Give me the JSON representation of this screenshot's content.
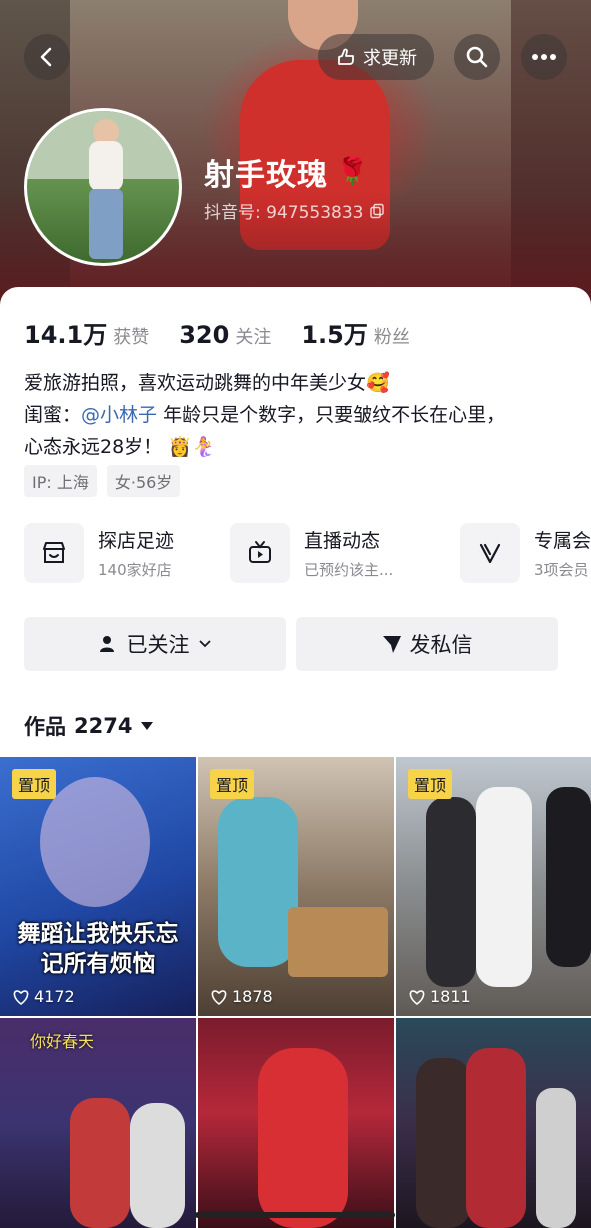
{
  "header": {
    "back_icon": "chevron-left-icon",
    "request_update_label": "求更新",
    "request_update_icon": "hand-pointing-icon",
    "search_icon": "search-icon",
    "more_icon": "ellipsis-icon"
  },
  "profile": {
    "name": "射手玫瑰",
    "name_emoji": "🌹",
    "douyin_id": "抖音号: 947553833",
    "copy_icon": "copy-icon"
  },
  "stats": [
    {
      "value": "14.1万",
      "label": "获赞"
    },
    {
      "value": "320",
      "label": "关注"
    },
    {
      "value": "1.5万",
      "label": "粉丝"
    }
  ],
  "bio": {
    "line1": "爱旅游拍照，喜欢运动跳舞的中年美少女🥰",
    "line2_prefix": "闺蜜：",
    "line2_mention": "@小林子",
    "line2_suffix": " 年龄只是个数字，只要皱纹不长在心里，",
    "line3": "心态永远28岁！ 👸🧜‍♀️"
  },
  "tags": [
    "IP: 上海",
    "女·56岁"
  ],
  "entries": [
    {
      "title": "探店足迹",
      "sub": "140家好店",
      "icon": "store-icon"
    },
    {
      "title": "直播动态",
      "sub": "已预约该主...",
      "icon": "tv-icon"
    },
    {
      "title": "专属会",
      "sub": "3项会员",
      "icon": "v-badge-icon"
    }
  ],
  "actions": {
    "followed_label": "已关注",
    "message_label": "发私信"
  },
  "works": {
    "label": "作品",
    "count": "2274"
  },
  "videos": [
    {
      "pinned": "置顶",
      "likes": "4172",
      "caption": "舞蹈让我快乐忘记所有烦恼"
    },
    {
      "pinned": "置顶",
      "likes": "1878"
    },
    {
      "pinned": "置顶",
      "likes": "1811"
    },
    {
      "caption": "你好春天"
    },
    {},
    {}
  ],
  "colors": {
    "mention": "#3b67b3",
    "pin_badge": "#f7d34a",
    "action_bg": "#f1f1f3"
  }
}
